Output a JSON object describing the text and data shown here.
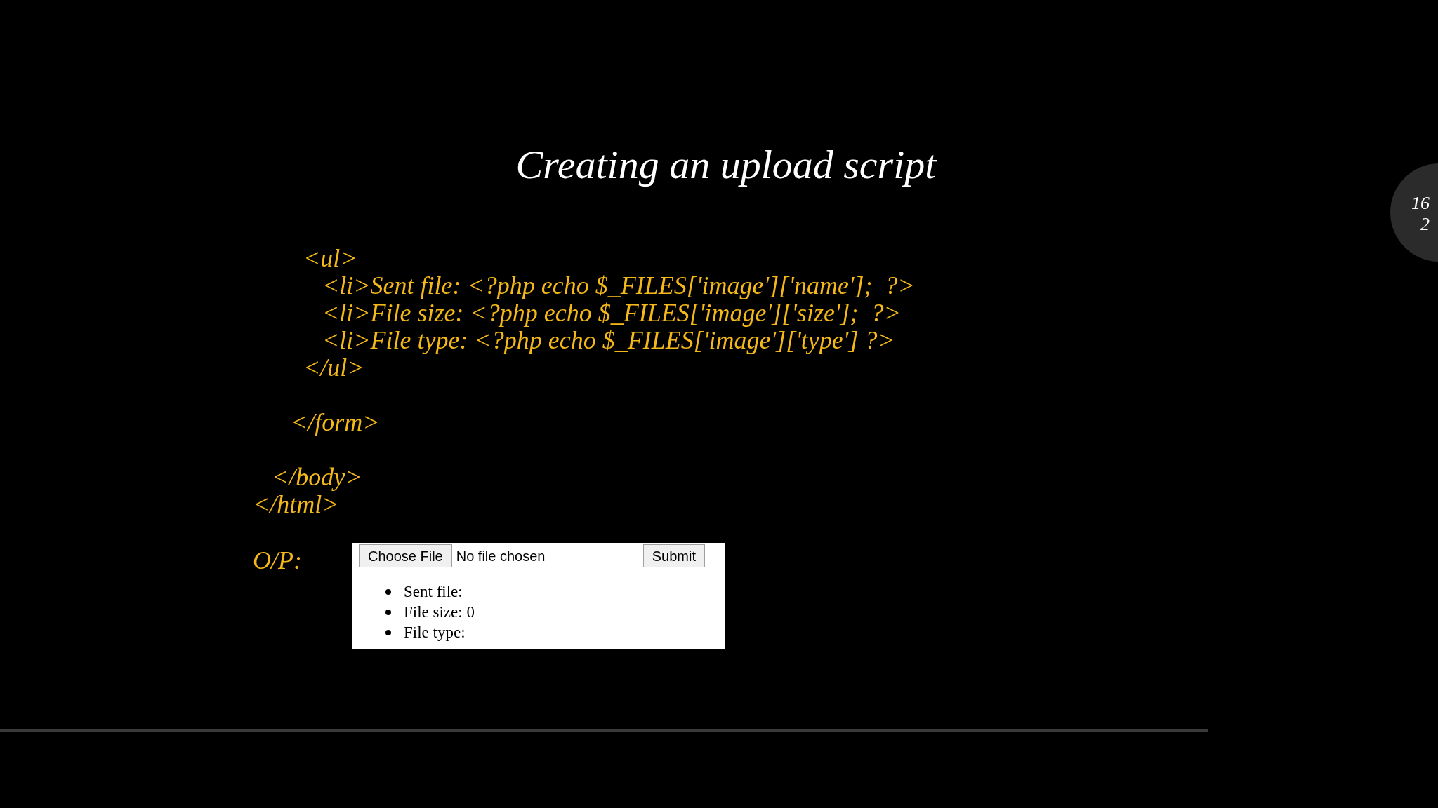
{
  "slide": {
    "title": "Creating an upload script",
    "code_lines": [
      {
        "kind": "code",
        "text": "        <ul>"
      },
      {
        "kind": "code",
        "text": "           <li>Sent file: <?php echo $_FILES['image']['name'];  ?>"
      },
      {
        "kind": "code",
        "text": "           <li>File size: <?php echo $_FILES['image']['size'];  ?>"
      },
      {
        "kind": "code",
        "text": "           <li>File type: <?php echo $_FILES['image']['type'] ?>"
      },
      {
        "kind": "code",
        "text": "        </ul>"
      },
      {
        "kind": "blank"
      },
      {
        "kind": "code",
        "text": "      </form>"
      },
      {
        "kind": "blank"
      },
      {
        "kind": "code",
        "text": "   </body>"
      },
      {
        "kind": "code",
        "text": "</html>"
      }
    ],
    "output_label": "O/P:",
    "output": {
      "choose_button": "Choose File",
      "file_status": "No file chosen",
      "submit_button": "Submit",
      "items": [
        "Sent file:",
        "File size: 0",
        "File type:"
      ]
    }
  },
  "page_badge": [
    "16",
    "2"
  ],
  "progress": {
    "level": 0.84
  }
}
